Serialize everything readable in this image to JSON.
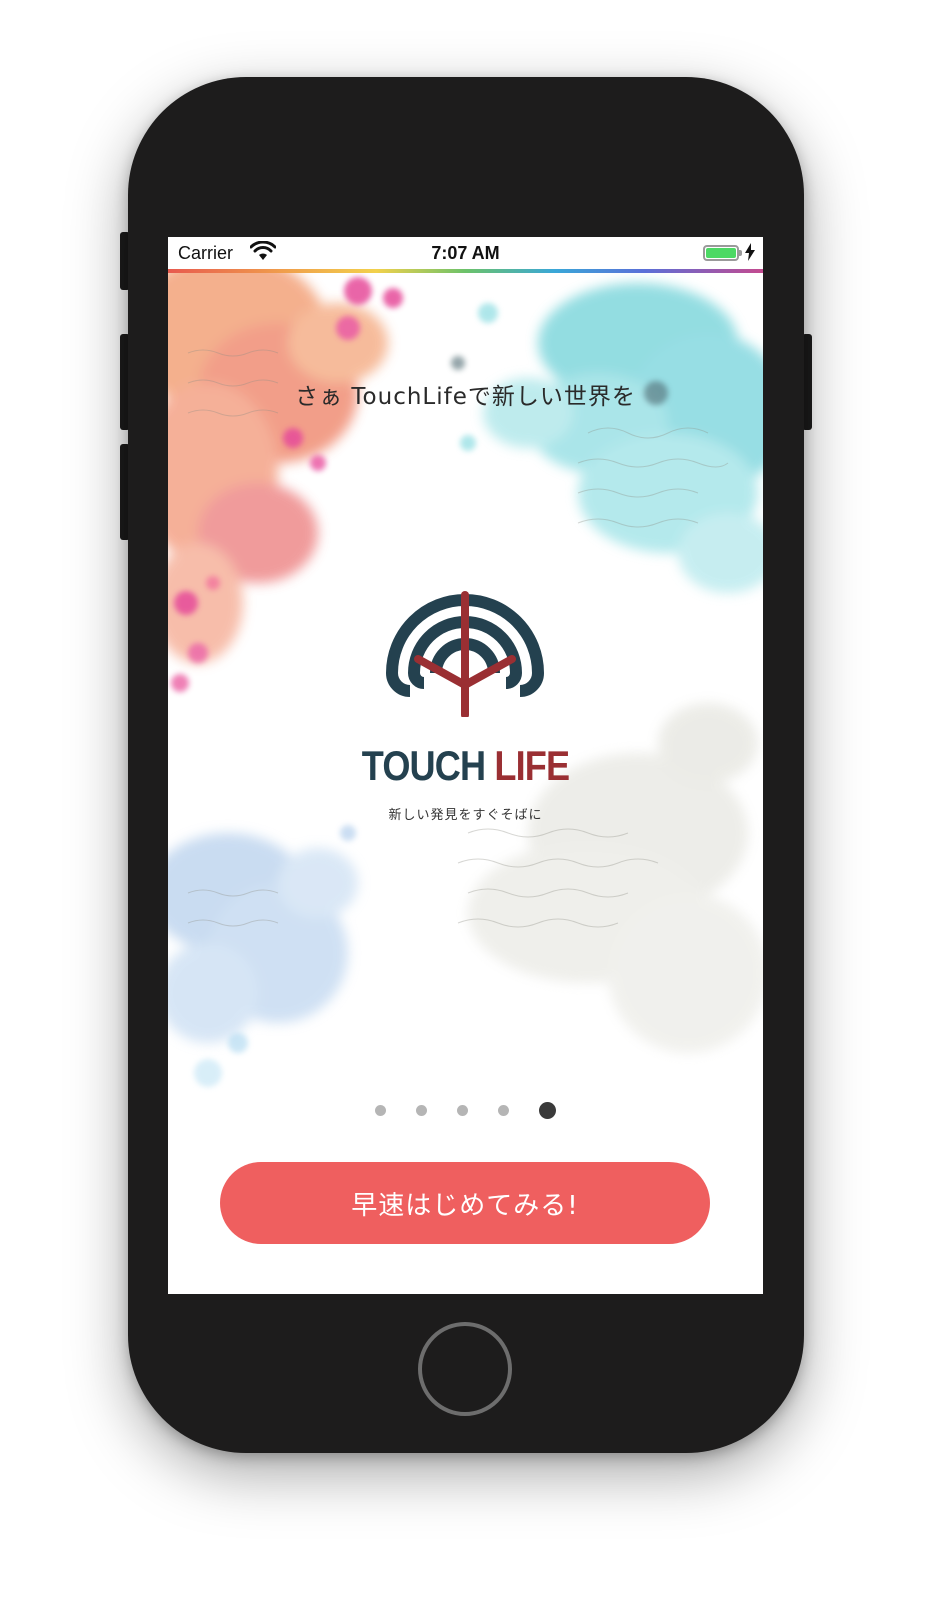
{
  "status_bar": {
    "carrier": "Carrier",
    "time": "7:07 AM",
    "battery_color": "#4cd964"
  },
  "onboarding": {
    "headline": "さぁ TouchLifeで新しい世界を",
    "brand": {
      "name_part1": "TOUCH",
      "name_part2": "LIFE",
      "tagline": "新しい発見をすぐそばに",
      "colors": {
        "primary": "#24414f",
        "accent": "#9a2f33"
      }
    },
    "page_indicator": {
      "total": 5,
      "current": 5
    },
    "cta_button": {
      "label": "早速はじめてみる!",
      "color": "#ef5f5f"
    }
  },
  "device": {
    "frame_color": "#1d1c1c",
    "icons": [
      "wifi-icon",
      "battery-icon",
      "charging-bolt-icon",
      "touchlife-logo-icon",
      "home-button"
    ]
  }
}
